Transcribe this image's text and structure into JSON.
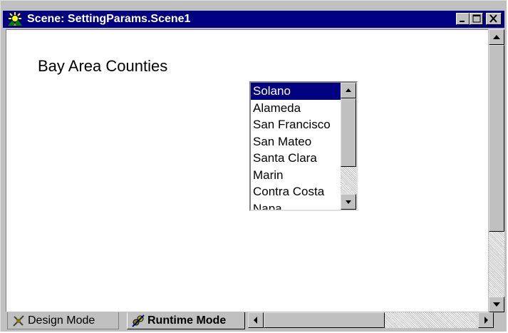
{
  "window": {
    "title": "Scene: SettingParams.Scene1",
    "controls": [
      "minimize",
      "maximize",
      "close"
    ]
  },
  "content": {
    "heading": "Bay Area Counties"
  },
  "listbox": {
    "selected": "Solano",
    "items": [
      "Solano",
      "Alameda",
      "San Francisco",
      "San Mateo",
      "Santa Clara",
      "Marin",
      "Contra Costa",
      "Napa"
    ]
  },
  "tabs": [
    {
      "label": "Design Mode",
      "icon": "design-mode-icon",
      "active": false
    },
    {
      "label": "Runtime Mode",
      "icon": "runtime-mode-icon",
      "active": true
    }
  ],
  "colors": {
    "titlebar": "#000080",
    "selection": "#000080",
    "chrome": "#c0c0c0"
  }
}
